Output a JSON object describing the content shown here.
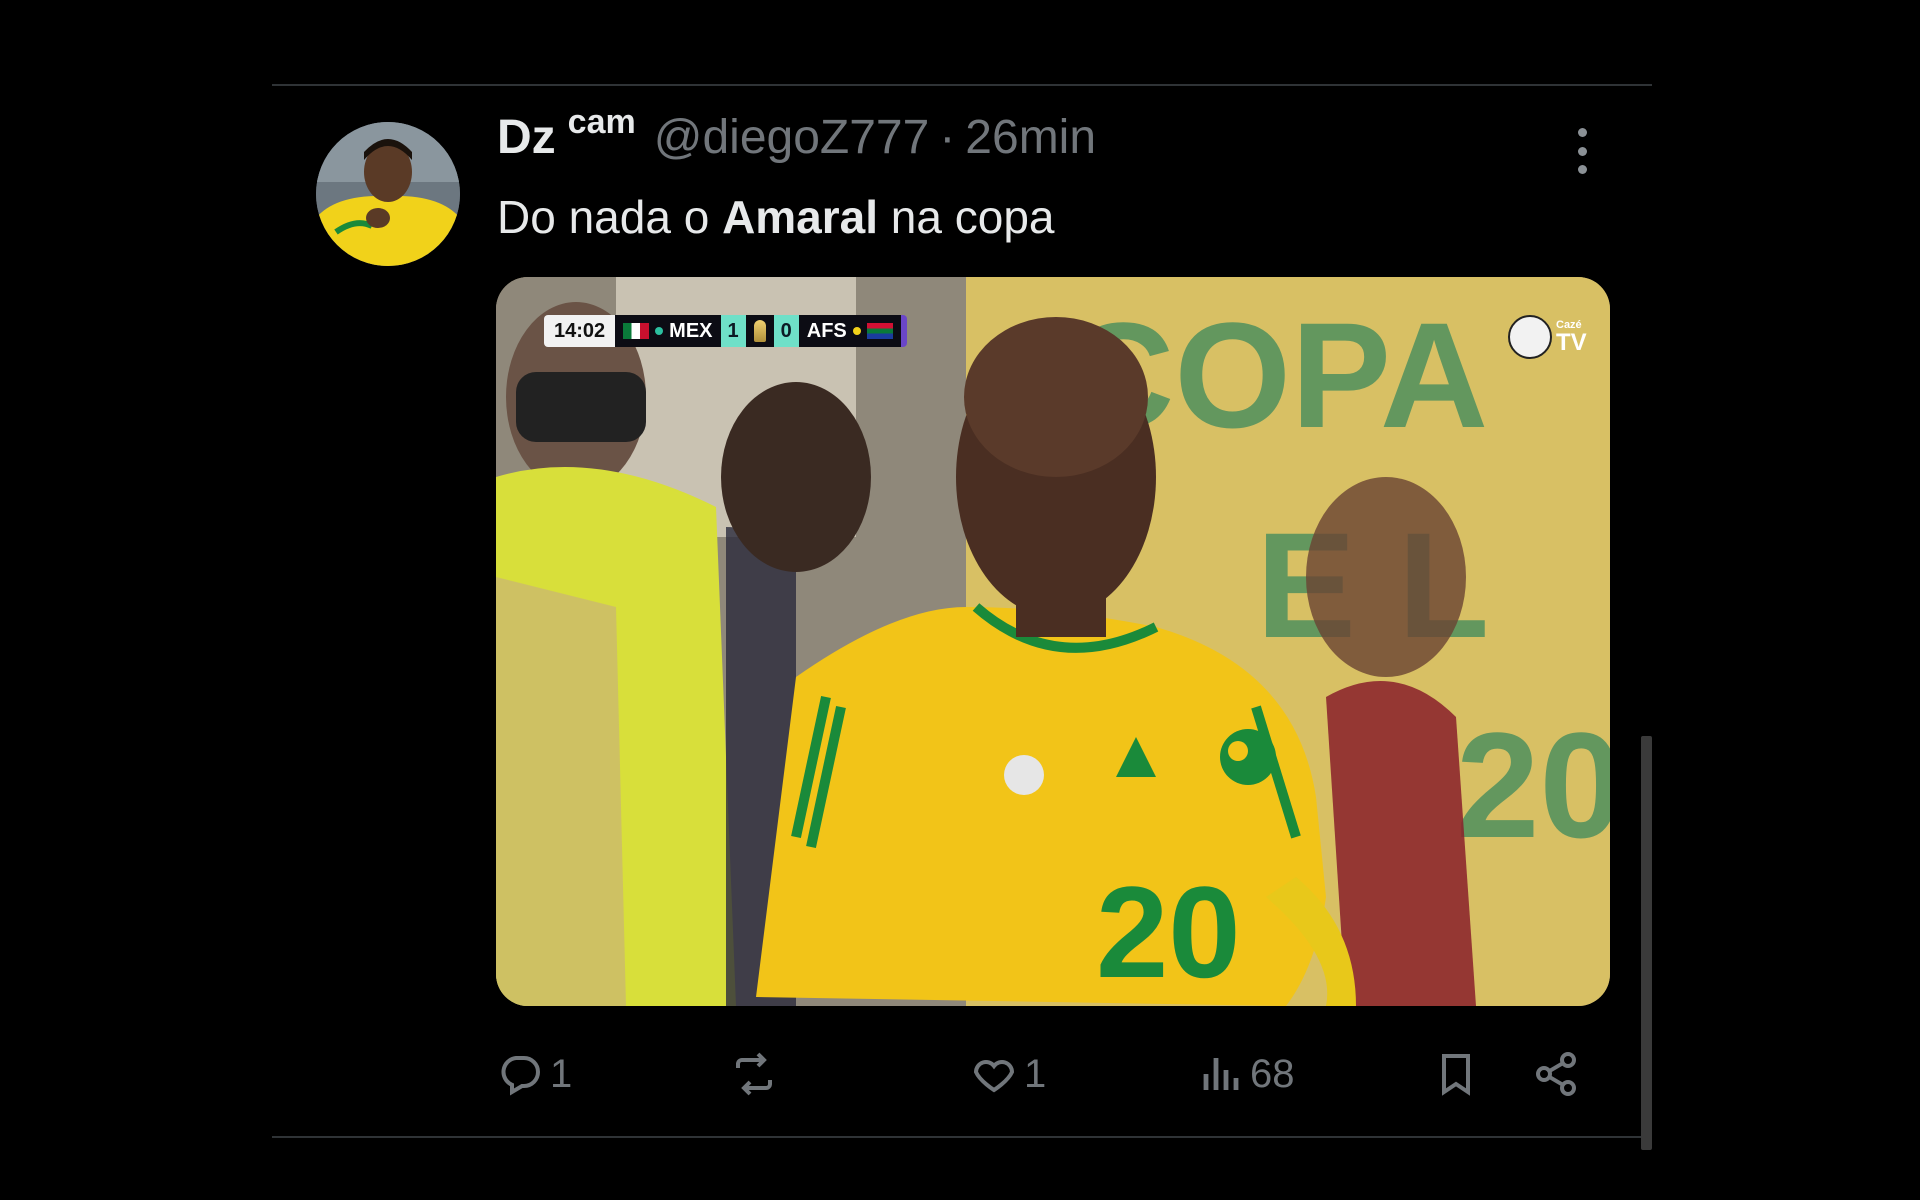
{
  "tweet": {
    "author_name": "Dz",
    "author_badge": "cam",
    "handle": "@diegoZ777",
    "separator": "·",
    "time": "26min",
    "text_before": "Do nada o ",
    "text_bold": "Amaral",
    "text_after": " na copa"
  },
  "media": {
    "scorebug": {
      "clock": "14:02",
      "home_team": "MEX",
      "home_score": "1",
      "away_score": "0",
      "away_team": "AFS"
    },
    "broadcaster_small": "Cazé",
    "broadcaster_large": "TV",
    "jersey_number": "20",
    "banner_text": [
      "COPA",
      "E L",
      "20"
    ]
  },
  "actions": {
    "reply_count": "1",
    "like_count": "1",
    "views_count": "68"
  },
  "colors": {
    "background": "#000000",
    "text_primary": "#e7e9ea",
    "text_secondary": "#71767b",
    "divider": "#2f3336",
    "jersey_yellow": "#f2c418",
    "jersey_green": "#1a8a3a"
  },
  "icons": [
    "more-icon",
    "reply-icon",
    "retweet-icon",
    "like-icon",
    "views-icon",
    "bookmark-icon",
    "share-icon"
  ]
}
